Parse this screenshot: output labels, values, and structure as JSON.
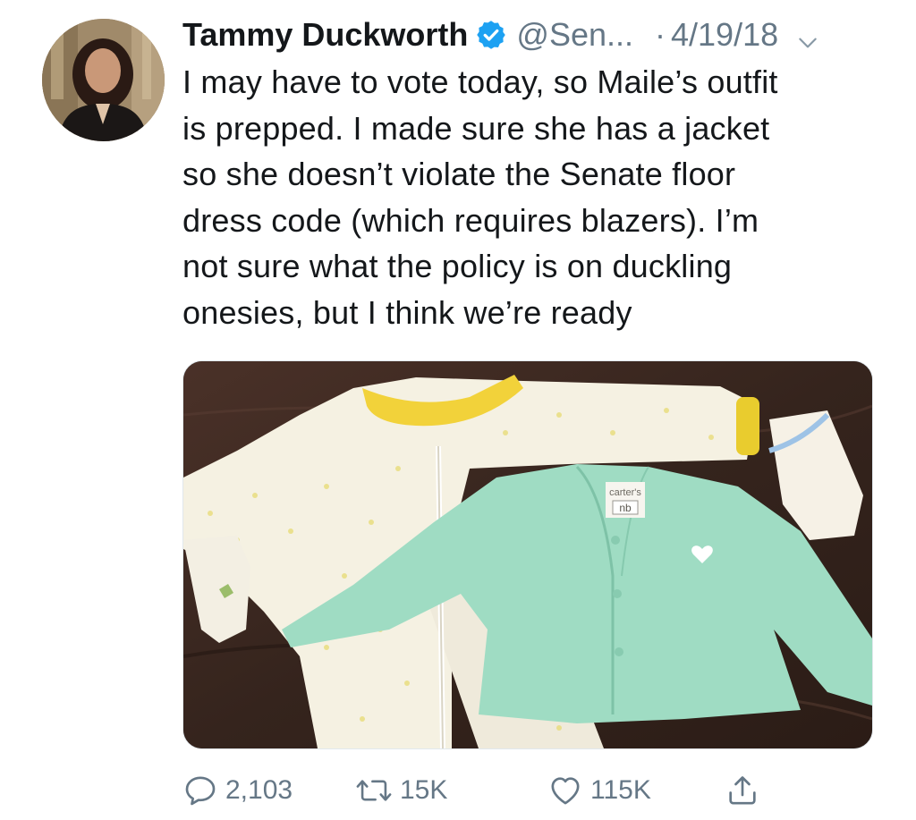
{
  "author": {
    "name": "Tammy Duckworth",
    "handle": "@Sen...",
    "date_separator": "·",
    "date": "4/19/18",
    "verified": true,
    "avatar_icon": "profile-photo"
  },
  "tweet": {
    "text_lines": [
      "I may have to vote today, so Maile’s outfit",
      "is prepped. I made sure she has a jacket",
      "so she doesn’t violate the Senate floor",
      "dress code (which requires blazers). I’m",
      "not sure what the policy is on duckling",
      "onesies, but I think we’re ready"
    ]
  },
  "media": {
    "label_brand": "carter's",
    "label_size": "nb"
  },
  "actions": {
    "reply_count": "2,103",
    "retweet_count": "15K",
    "like_count": "115K"
  },
  "colors": {
    "text": "#14171a",
    "secondary": "#657786",
    "verified_blue": "#1da1f2"
  }
}
